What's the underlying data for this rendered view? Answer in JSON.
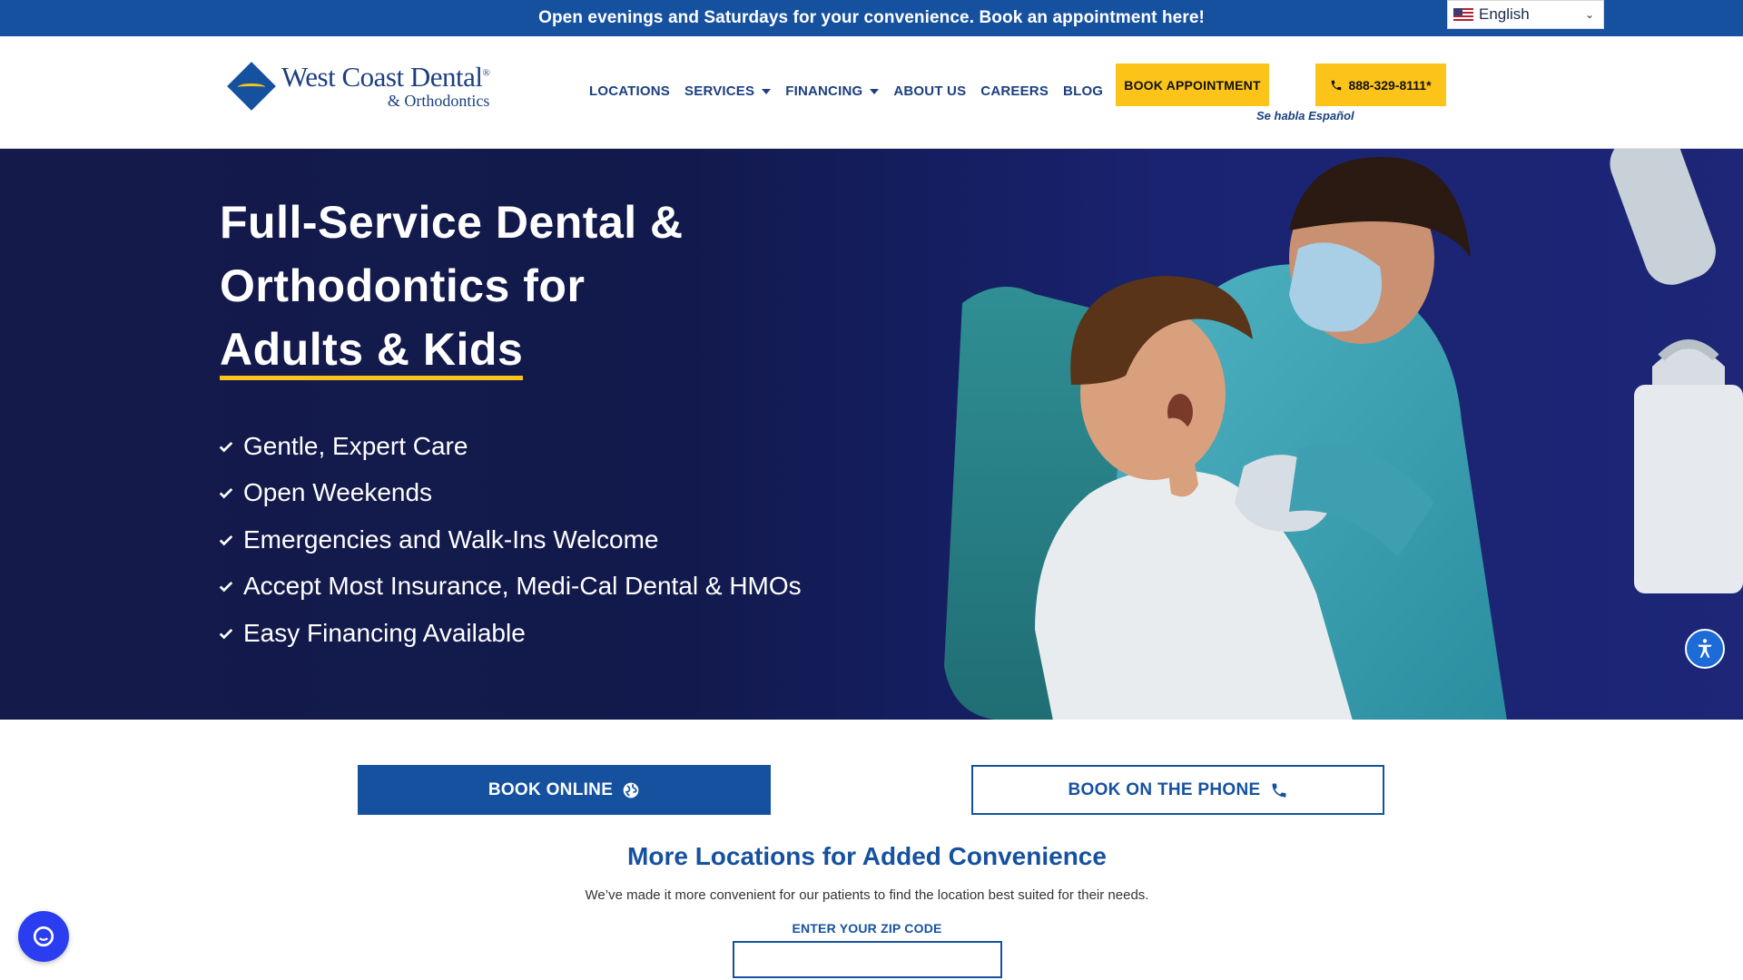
{
  "topbar": {
    "announcement": "Open evenings and Saturdays for your convenience. Book an appointment here!",
    "language": {
      "selected": "English",
      "icon": "us-flag-icon"
    }
  },
  "header": {
    "logo": {
      "title": "West Coast Dental",
      "registered": "®",
      "subtitle": "& Orthodontics"
    },
    "nav": [
      {
        "label": "LOCATIONS",
        "dropdown": false
      },
      {
        "label": "SERVICES",
        "dropdown": true
      },
      {
        "label": "FINANCING",
        "dropdown": true
      },
      {
        "label": "ABOUT US",
        "dropdown": false
      },
      {
        "label": "CAREERS",
        "dropdown": false
      },
      {
        "label": "BLOG",
        "dropdown": false
      }
    ],
    "book_button": "BOOK APPOINTMENT",
    "phone_button": "888-329-8111*",
    "spanish_note": "Se habla Español"
  },
  "hero": {
    "title_line1": "Full-Service Dental &",
    "title_line2": "Orthodontics for",
    "title_line3": "Adults & Kids",
    "checklist": [
      "Gentle, Expert Care",
      "Open Weekends",
      "Emergencies and Walk-Ins Welcome",
      "Accept Most Insurance, Medi-Cal Dental & HMOs",
      "Easy Financing Available"
    ]
  },
  "cta": {
    "book_online": "BOOK ONLINE",
    "book_phone": "BOOK ON THE PHONE"
  },
  "locations": {
    "title": "More Locations for Added Convenience",
    "subtitle": "We’ve made it more convenient for our patients to find the location best suited for their needs.",
    "zip_label": "ENTER YOUR ZIP CODE",
    "zip_value": "",
    "zip_placeholder": ""
  },
  "colors": {
    "brand_blue": "#1651a0",
    "accent_yellow": "#fcc419",
    "hero_navy": "#141a4a"
  }
}
